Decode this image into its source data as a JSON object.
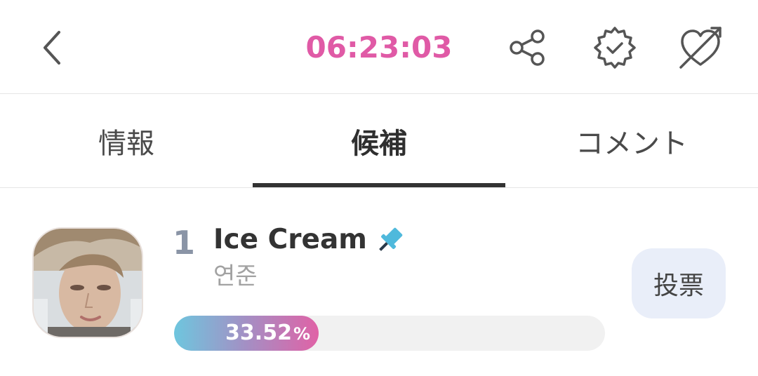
{
  "header": {
    "timer": "06:23:03",
    "timer_color": "#e05aa6",
    "icons": [
      "back-arrow-icon",
      "share-icon",
      "verified-badge-icon",
      "heart-arrow-icon"
    ]
  },
  "tabs": [
    {
      "label": "情報",
      "active": false
    },
    {
      "label": "候補",
      "active": true
    },
    {
      "label": "コメント",
      "active": false
    }
  ],
  "candidate": {
    "rank": "1",
    "title": "Ice Cream",
    "artist": "연준",
    "percent_value": "33.52",
    "percent_sign": "%",
    "percent_fraction": 0.3352,
    "pinned": true,
    "pin_icon": "pin-icon",
    "vote_label": "投票"
  },
  "colors": {
    "accent_pink": "#e05aa6",
    "accent_blue": "#6ec6de",
    "vote_button_bg": "#e9eef9"
  }
}
